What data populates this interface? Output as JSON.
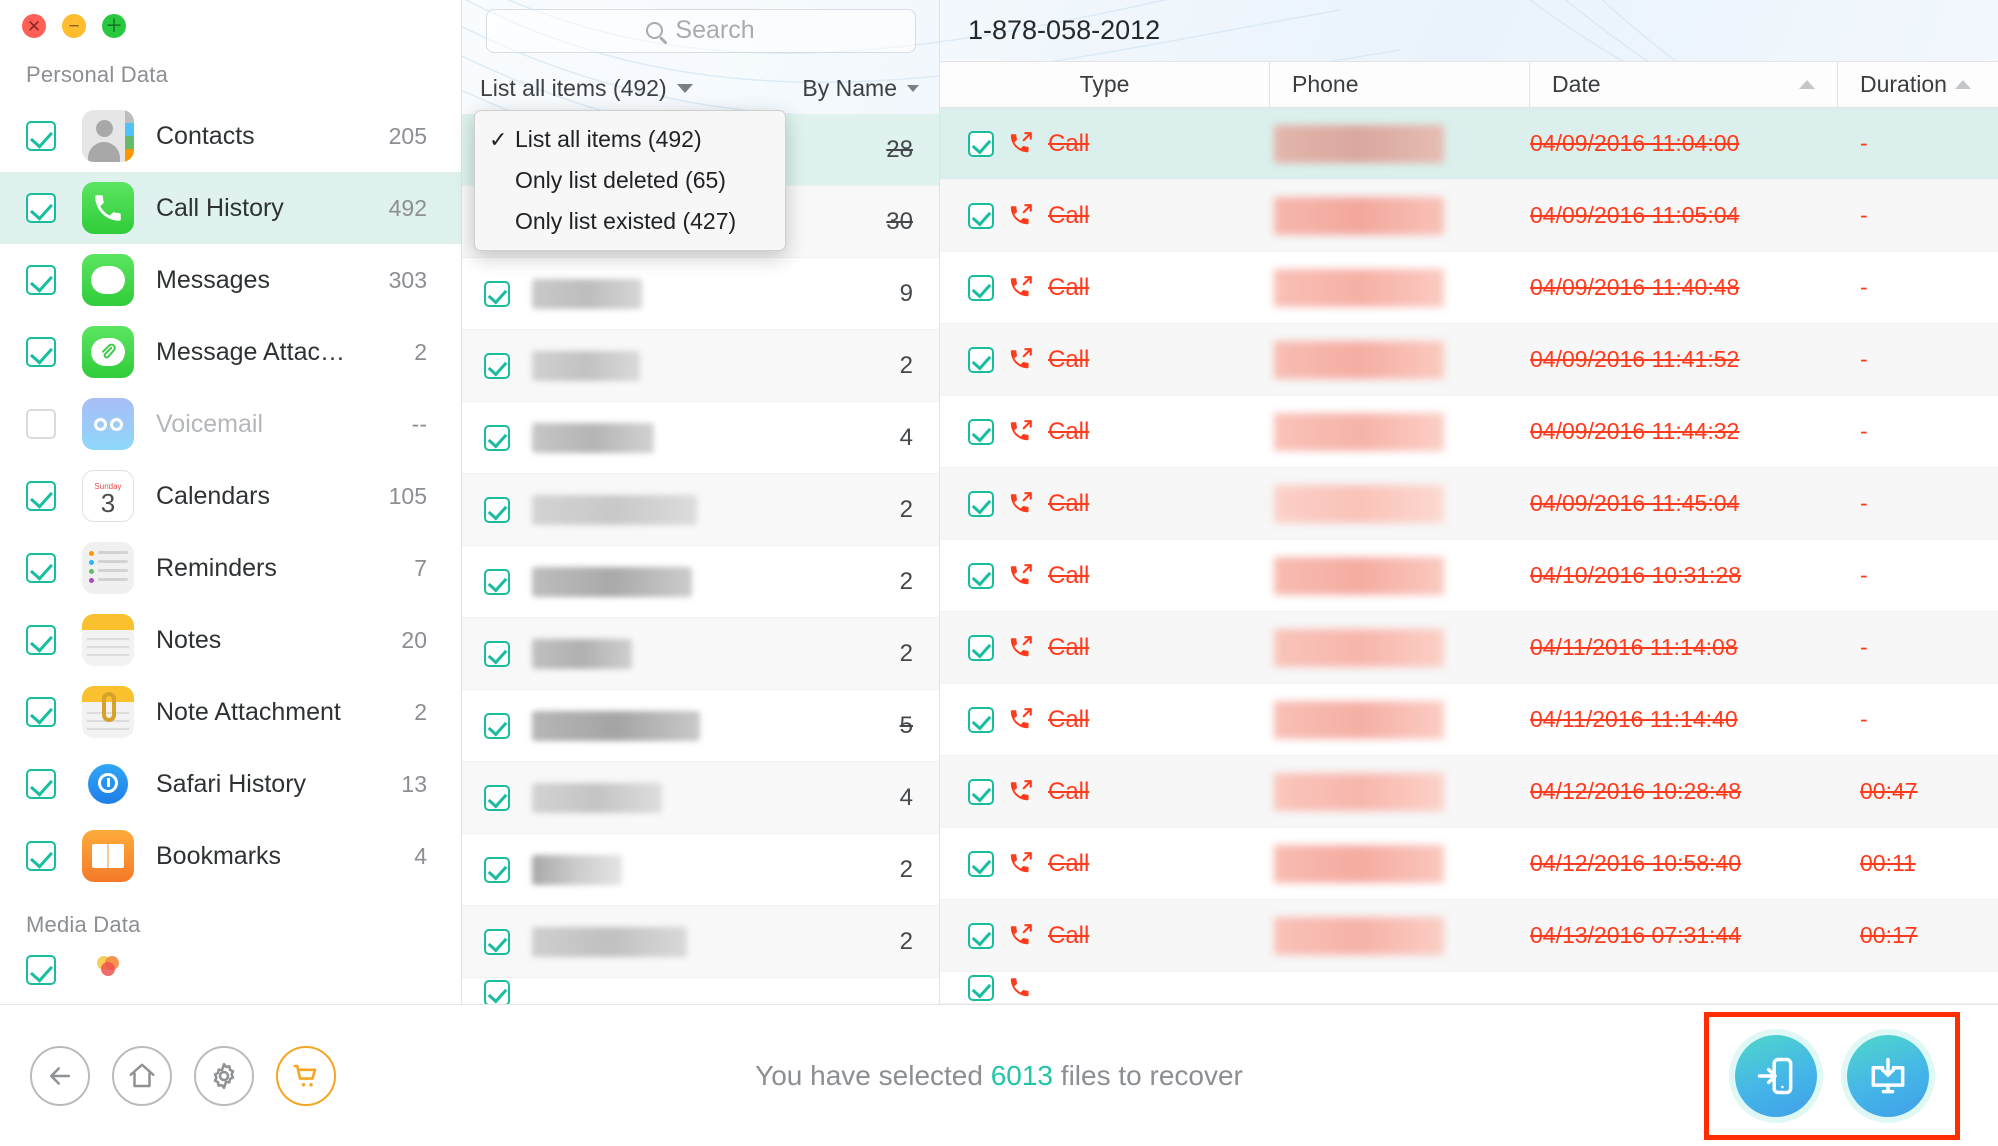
{
  "window": {
    "controls": [
      {
        "name": "close",
        "color": "#ff5f57"
      },
      {
        "name": "minimize",
        "color": "#febc2e"
      },
      {
        "name": "zoom",
        "color": "#28c840"
      }
    ]
  },
  "sidebar": {
    "sections": [
      {
        "title": "Personal Data",
        "items": [
          {
            "label": "Contacts",
            "count": "205",
            "checked": true,
            "selected": false,
            "icon": "contacts-icon"
          },
          {
            "label": "Call History",
            "count": "492",
            "checked": true,
            "selected": true,
            "icon": "phone-icon"
          },
          {
            "label": "Messages",
            "count": "303",
            "checked": true,
            "selected": false,
            "icon": "messages-icon"
          },
          {
            "label": "Message Attac…",
            "count": "2",
            "checked": true,
            "selected": false,
            "icon": "message-attachment-icon"
          },
          {
            "label": "Voicemail",
            "count": "--",
            "checked": false,
            "selected": false,
            "icon": "voicemail-icon"
          },
          {
            "label": "Calendars",
            "count": "105",
            "checked": true,
            "selected": false,
            "icon": "calendar-icon"
          },
          {
            "label": "Reminders",
            "count": "7",
            "checked": true,
            "selected": false,
            "icon": "reminders-icon"
          },
          {
            "label": "Notes",
            "count": "20",
            "checked": true,
            "selected": false,
            "icon": "notes-icon"
          },
          {
            "label": "Note Attachment",
            "count": "2",
            "checked": true,
            "selected": false,
            "icon": "note-attachment-icon"
          },
          {
            "label": "Safari History",
            "count": "13",
            "checked": true,
            "selected": false,
            "icon": "safari-icon"
          },
          {
            "label": "Bookmarks",
            "count": "4",
            "checked": true,
            "selected": false,
            "icon": "bookmarks-icon"
          }
        ]
      },
      {
        "title": "Media Data",
        "items": [
          {
            "label": "",
            "count": "",
            "checked": true,
            "selected": false,
            "icon": "photos-icon"
          }
        ]
      }
    ],
    "calendar_icon": {
      "weekday": "Sunday",
      "day": "3"
    }
  },
  "middle": {
    "search": {
      "placeholder": "Search",
      "value": "",
      "icon": "search-icon"
    },
    "filter": {
      "label": "List all items (492)",
      "icon": "chevron-down-icon"
    },
    "sort": {
      "label": "By Name",
      "icon": "chevron-down-icon"
    },
    "dropdown": {
      "open": true,
      "checkmark": "✓",
      "options": [
        {
          "label": "List all items (492)",
          "selected": true
        },
        {
          "label": "Only list deleted (65)",
          "selected": false
        },
        {
          "label": "Only list existed (427)",
          "selected": false
        }
      ]
    },
    "rows": [
      {
        "count": "28",
        "selected": true,
        "name_w": 0,
        "strike": true
      },
      {
        "count": "30",
        "selected": false,
        "name_w": 130,
        "strike": true
      },
      {
        "count": "9",
        "selected": false,
        "name_w": 110,
        "strike": false
      },
      {
        "count": "2",
        "selected": false,
        "name_w": 108,
        "strike": false
      },
      {
        "count": "4",
        "selected": false,
        "name_w": 122,
        "strike": false
      },
      {
        "count": "2",
        "selected": false,
        "name_w": 165,
        "strike": false
      },
      {
        "count": "2",
        "selected": false,
        "name_w": 160,
        "strike": false
      },
      {
        "count": "2",
        "selected": false,
        "name_w": 100,
        "strike": false
      },
      {
        "count": "5",
        "selected": false,
        "name_w": 168,
        "strike": true
      },
      {
        "count": "4",
        "selected": false,
        "name_w": 130,
        "strike": false
      },
      {
        "count": "2",
        "selected": false,
        "name_w": 90,
        "strike": false
      },
      {
        "count": "2",
        "selected": false,
        "name_w": 155,
        "strike": false
      }
    ]
  },
  "table": {
    "title": "1-878-058-2012",
    "columns": [
      {
        "label": "Type",
        "sortable": false,
        "sort": null
      },
      {
        "label": "Phone",
        "sortable": false,
        "sort": null
      },
      {
        "label": "Date",
        "sortable": true,
        "sort": "asc"
      },
      {
        "label": "Duration",
        "sortable": true,
        "sort": "asc"
      }
    ],
    "rows": [
      {
        "checked": true,
        "type": "Call",
        "phone": "",
        "date": "04/09/2016 11:04:00",
        "duration": "-",
        "selected": true,
        "deleted": true
      },
      {
        "checked": true,
        "type": "Call",
        "phone": "",
        "date": "04/09/2016 11:05:04",
        "duration": "-",
        "selected": false,
        "deleted": true
      },
      {
        "checked": true,
        "type": "Call",
        "phone": "",
        "date": "04/09/2016 11:40:48",
        "duration": "-",
        "selected": false,
        "deleted": true
      },
      {
        "checked": true,
        "type": "Call",
        "phone": "",
        "date": "04/09/2016 11:41:52",
        "duration": "-",
        "selected": false,
        "deleted": true
      },
      {
        "checked": true,
        "type": "Call",
        "phone": "",
        "date": "04/09/2016 11:44:32",
        "duration": "-",
        "selected": false,
        "deleted": true
      },
      {
        "checked": true,
        "type": "Call",
        "phone": "",
        "date": "04/09/2016 11:45:04",
        "duration": "-",
        "selected": false,
        "deleted": true
      },
      {
        "checked": true,
        "type": "Call",
        "phone": "",
        "date": "04/10/2016 10:31:28",
        "duration": "-",
        "selected": false,
        "deleted": true
      },
      {
        "checked": true,
        "type": "Call",
        "phone": "",
        "date": "04/11/2016 11:14:08",
        "duration": "-",
        "selected": false,
        "deleted": true
      },
      {
        "checked": true,
        "type": "Call",
        "phone": "",
        "date": "04/11/2016 11:14:40",
        "duration": "-",
        "selected": false,
        "deleted": true
      },
      {
        "checked": true,
        "type": "Call",
        "phone": "",
        "date": "04/12/2016 10:28:48",
        "duration": "00:47",
        "selected": false,
        "deleted": true
      },
      {
        "checked": true,
        "type": "Call",
        "phone": "",
        "date": "04/12/2016 10:58:40",
        "duration": "00:11",
        "selected": false,
        "deleted": true
      },
      {
        "checked": true,
        "type": "Call",
        "phone": "",
        "date": "04/13/2016 07:31:44",
        "duration": "00:17",
        "selected": false,
        "deleted": true
      }
    ]
  },
  "footer": {
    "nav_icons": [
      {
        "name": "back-icon"
      },
      {
        "name": "home-icon"
      },
      {
        "name": "gear-icon"
      },
      {
        "name": "cart-icon"
      }
    ],
    "status_prefix": "You have selected ",
    "status_count": "6013",
    "status_suffix": " files to recover",
    "recover_buttons": [
      {
        "name": "recover-to-device-button",
        "icon": "phone-import-icon"
      },
      {
        "name": "recover-to-computer-button",
        "icon": "monitor-download-icon"
      }
    ],
    "highlight_color": "#ff2d00"
  },
  "colors": {
    "accent": "#23c4a8",
    "deleted_red": "#ff3b1e",
    "selection": "#dff2ee",
    "cart_orange": "#f5a623"
  }
}
